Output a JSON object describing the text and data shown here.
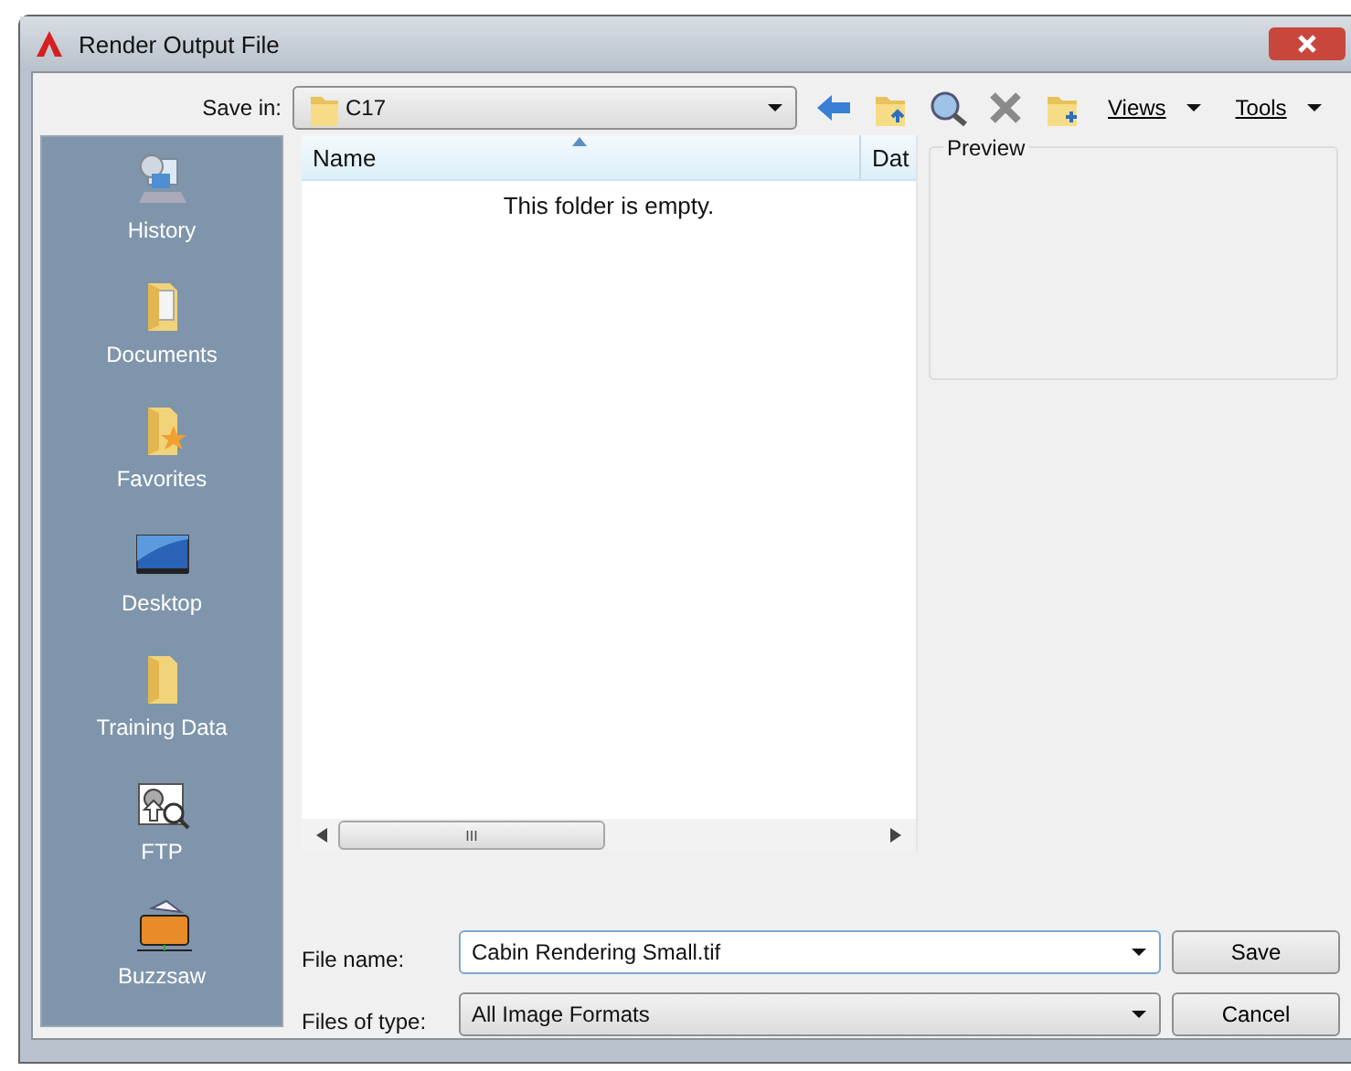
{
  "window": {
    "title": "Render Output File"
  },
  "save_in": {
    "label": "Save in:",
    "value": "C17"
  },
  "toolbar": {
    "views": "Views",
    "tools": "Tools"
  },
  "places": [
    {
      "label": "History"
    },
    {
      "label": "Documents"
    },
    {
      "label": "Favorites"
    },
    {
      "label": "Desktop"
    },
    {
      "label": "Training Data"
    },
    {
      "label": "FTP"
    },
    {
      "label": "Buzzsaw"
    }
  ],
  "file_list": {
    "columns": [
      "Name",
      "Dat"
    ],
    "empty_message": "This folder is empty.",
    "scroll_grip": "III"
  },
  "preview": {
    "label": "Preview"
  },
  "file_name": {
    "label": "File name:",
    "value": "Cabin Rendering Small.tif"
  },
  "file_type": {
    "label": "Files of type:",
    "value": "All Image Formats"
  },
  "buttons": [
    "Save",
    "Cancel"
  ]
}
